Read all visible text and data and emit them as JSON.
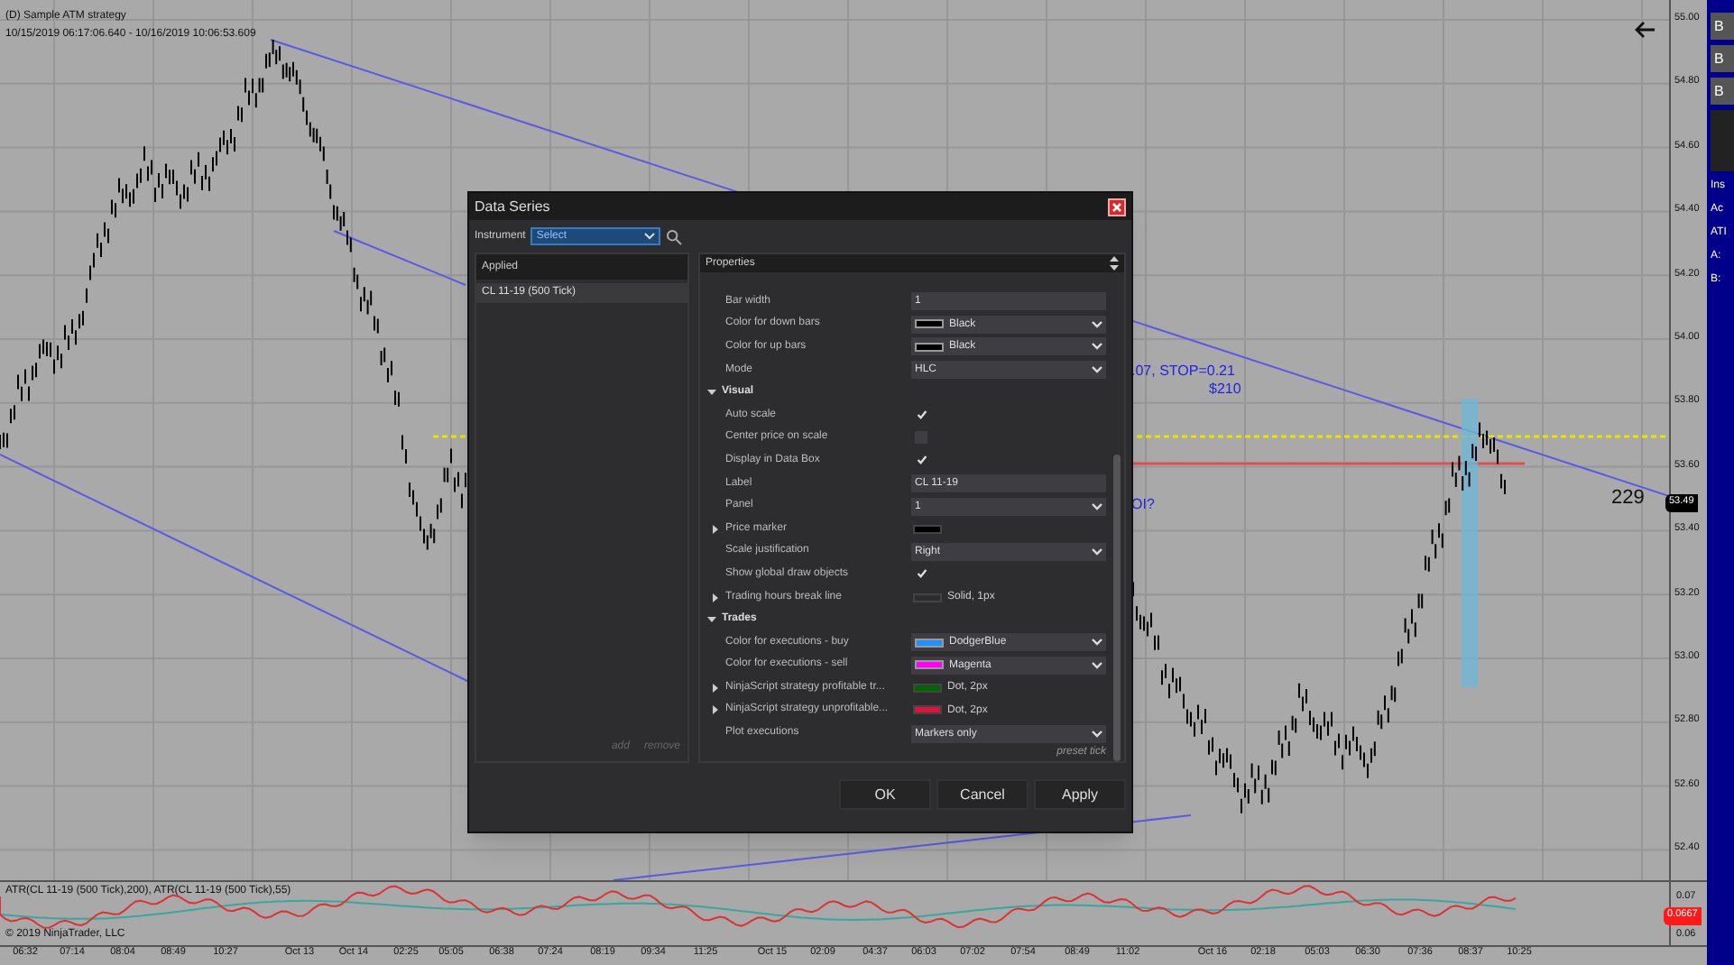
{
  "chart": {
    "title": "(D) Sample ATM strategy",
    "date_range": "10/15/2019 06:17:06.640 - 10/16/2019 10:06:53.609",
    "annotations": [
      ".07, STOP=0.21",
      "$210",
      "OI?",
      "229"
    ],
    "price_axis": [
      "55.00",
      "54.80",
      "54.60",
      "54.40",
      "54.20",
      "54.00",
      "53.80",
      "53.60",
      "53.40",
      "53.20",
      "53.00",
      "52.80",
      "52.60",
      "52.40"
    ],
    "price_marker": "53.49"
  },
  "indicator_panel": {
    "label": "ATR(CL 11-19 (500 Tick),200), ATR(CL 11-19 (500 Tick),55)",
    "copyright": "© 2019 NinjaTrader, LLC",
    "axis": [
      "0.07",
      "0.06"
    ],
    "value_marker": "0.0667"
  },
  "time_axis": [
    "06:32",
    "07:14",
    "08:04",
    "08:49",
    "10:27",
    "Oct 13",
    "Oct 14",
    "02:25",
    "05:05",
    "06:38",
    "07:24",
    "08:19",
    "09:34",
    "11:25",
    "Oct 15",
    "02:09",
    "04:37",
    "06:03",
    "07:02",
    "07:54",
    "08:49",
    "11:02",
    "Oct 16",
    "02:18",
    "05:03",
    "06:30",
    "07:36",
    "08:37",
    "10:25"
  ],
  "side_panel": {
    "buttons": [
      "B",
      "B",
      "B"
    ],
    "labels": [
      "Ins",
      "Ac",
      "ATI",
      "A:",
      "B:"
    ]
  },
  "dialog": {
    "title": "Data Series",
    "instrument_label": "Instrument",
    "instrument_value": "Select",
    "applied_header": "Applied",
    "applied": [
      {
        "label": "CL 11-19 (500 Tick)",
        "selected": true
      }
    ],
    "add": "add",
    "remove": "remove",
    "properties_header": "Properties",
    "properties": [
      {
        "kind": "text",
        "label": "Bar width",
        "value": "1"
      },
      {
        "kind": "color",
        "label": "Color for down bars",
        "value": "Black",
        "color": "#000000"
      },
      {
        "kind": "color",
        "label": "Color for up bars",
        "value": "Black",
        "color": "#000000"
      },
      {
        "kind": "dropdown",
        "label": "Mode",
        "value": "HLC"
      },
      {
        "kind": "category",
        "label": "Visual",
        "expanded": true
      },
      {
        "kind": "checkbox",
        "label": "Auto scale",
        "checked": true
      },
      {
        "kind": "checkbox",
        "label": "Center price on scale",
        "checked": false
      },
      {
        "kind": "checkbox",
        "label": "Display in Data Box",
        "checked": true
      },
      {
        "kind": "text",
        "label": "Label",
        "value": "CL 11-19"
      },
      {
        "kind": "dropdown",
        "label": "Panel",
        "value": "1"
      },
      {
        "kind": "swatch",
        "label": "Price marker",
        "expanded": false,
        "color": "#000000"
      },
      {
        "kind": "dropdown",
        "label": "Scale justification",
        "value": "Right"
      },
      {
        "kind": "checkbox",
        "label": "Show global draw objects",
        "checked": true
      },
      {
        "kind": "swatch",
        "label": "Trading hours break line",
        "expanded": false,
        "value": "Solid, 1px",
        "color": "#2d2d30"
      },
      {
        "kind": "category",
        "label": "Trades",
        "expanded": true
      },
      {
        "kind": "color",
        "label": "Color for executions - buy",
        "value": "DodgerBlue",
        "color": "#1e90ff"
      },
      {
        "kind": "color",
        "label": "Color for executions - sell",
        "value": "Magenta",
        "color": "#ff00ff"
      },
      {
        "kind": "swatch",
        "label": "NinjaScript strategy profitable tr...",
        "expanded": false,
        "value": "Dot, 2px",
        "color": "#006400"
      },
      {
        "kind": "swatch",
        "label": "NinjaScript strategy unprofitable...",
        "expanded": false,
        "value": "Dot, 2px",
        "color": "#dc143c"
      },
      {
        "kind": "dropdown",
        "label": "Plot executions",
        "value": "Markers only"
      }
    ],
    "preset": "preset tick",
    "buttons": [
      "OK",
      "Cancel",
      "Apply"
    ]
  }
}
